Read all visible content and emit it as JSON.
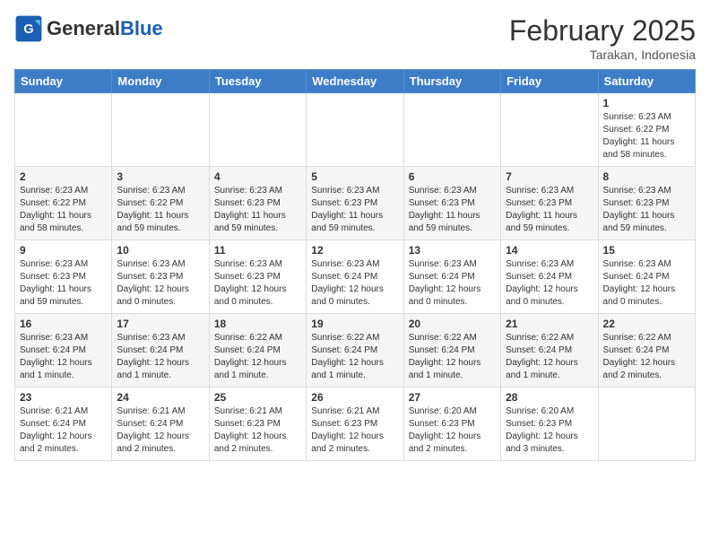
{
  "header": {
    "logo_general": "General",
    "logo_blue": "Blue",
    "month_title": "February 2025",
    "subtitle": "Tarakan, Indonesia"
  },
  "weekdays": [
    "Sunday",
    "Monday",
    "Tuesday",
    "Wednesday",
    "Thursday",
    "Friday",
    "Saturday"
  ],
  "weeks": [
    [
      {
        "day": "",
        "info": ""
      },
      {
        "day": "",
        "info": ""
      },
      {
        "day": "",
        "info": ""
      },
      {
        "day": "",
        "info": ""
      },
      {
        "day": "",
        "info": ""
      },
      {
        "day": "",
        "info": ""
      },
      {
        "day": "1",
        "info": "Sunrise: 6:23 AM\nSunset: 6:22 PM\nDaylight: 11 hours\nand 58 minutes."
      }
    ],
    [
      {
        "day": "2",
        "info": "Sunrise: 6:23 AM\nSunset: 6:22 PM\nDaylight: 11 hours\nand 58 minutes."
      },
      {
        "day": "3",
        "info": "Sunrise: 6:23 AM\nSunset: 6:22 PM\nDaylight: 11 hours\nand 59 minutes."
      },
      {
        "day": "4",
        "info": "Sunrise: 6:23 AM\nSunset: 6:23 PM\nDaylight: 11 hours\nand 59 minutes."
      },
      {
        "day": "5",
        "info": "Sunrise: 6:23 AM\nSunset: 6:23 PM\nDaylight: 11 hours\nand 59 minutes."
      },
      {
        "day": "6",
        "info": "Sunrise: 6:23 AM\nSunset: 6:23 PM\nDaylight: 11 hours\nand 59 minutes."
      },
      {
        "day": "7",
        "info": "Sunrise: 6:23 AM\nSunset: 6:23 PM\nDaylight: 11 hours\nand 59 minutes."
      },
      {
        "day": "8",
        "info": "Sunrise: 6:23 AM\nSunset: 6:23 PM\nDaylight: 11 hours\nand 59 minutes."
      }
    ],
    [
      {
        "day": "9",
        "info": "Sunrise: 6:23 AM\nSunset: 6:23 PM\nDaylight: 11 hours\nand 59 minutes."
      },
      {
        "day": "10",
        "info": "Sunrise: 6:23 AM\nSunset: 6:23 PM\nDaylight: 12 hours\nand 0 minutes."
      },
      {
        "day": "11",
        "info": "Sunrise: 6:23 AM\nSunset: 6:23 PM\nDaylight: 12 hours\nand 0 minutes."
      },
      {
        "day": "12",
        "info": "Sunrise: 6:23 AM\nSunset: 6:24 PM\nDaylight: 12 hours\nand 0 minutes."
      },
      {
        "day": "13",
        "info": "Sunrise: 6:23 AM\nSunset: 6:24 PM\nDaylight: 12 hours\nand 0 minutes."
      },
      {
        "day": "14",
        "info": "Sunrise: 6:23 AM\nSunset: 6:24 PM\nDaylight: 12 hours\nand 0 minutes."
      },
      {
        "day": "15",
        "info": "Sunrise: 6:23 AM\nSunset: 6:24 PM\nDaylight: 12 hours\nand 0 minutes."
      }
    ],
    [
      {
        "day": "16",
        "info": "Sunrise: 6:23 AM\nSunset: 6:24 PM\nDaylight: 12 hours\nand 1 minute."
      },
      {
        "day": "17",
        "info": "Sunrise: 6:23 AM\nSunset: 6:24 PM\nDaylight: 12 hours\nand 1 minute."
      },
      {
        "day": "18",
        "info": "Sunrise: 6:22 AM\nSunset: 6:24 PM\nDaylight: 12 hours\nand 1 minute."
      },
      {
        "day": "19",
        "info": "Sunrise: 6:22 AM\nSunset: 6:24 PM\nDaylight: 12 hours\nand 1 minute."
      },
      {
        "day": "20",
        "info": "Sunrise: 6:22 AM\nSunset: 6:24 PM\nDaylight: 12 hours\nand 1 minute."
      },
      {
        "day": "21",
        "info": "Sunrise: 6:22 AM\nSunset: 6:24 PM\nDaylight: 12 hours\nand 1 minute."
      },
      {
        "day": "22",
        "info": "Sunrise: 6:22 AM\nSunset: 6:24 PM\nDaylight: 12 hours\nand 2 minutes."
      }
    ],
    [
      {
        "day": "23",
        "info": "Sunrise: 6:21 AM\nSunset: 6:24 PM\nDaylight: 12 hours\nand 2 minutes."
      },
      {
        "day": "24",
        "info": "Sunrise: 6:21 AM\nSunset: 6:24 PM\nDaylight: 12 hours\nand 2 minutes."
      },
      {
        "day": "25",
        "info": "Sunrise: 6:21 AM\nSunset: 6:23 PM\nDaylight: 12 hours\nand 2 minutes."
      },
      {
        "day": "26",
        "info": "Sunrise: 6:21 AM\nSunset: 6:23 PM\nDaylight: 12 hours\nand 2 minutes."
      },
      {
        "day": "27",
        "info": "Sunrise: 6:20 AM\nSunset: 6:23 PM\nDaylight: 12 hours\nand 2 minutes."
      },
      {
        "day": "28",
        "info": "Sunrise: 6:20 AM\nSunset: 6:23 PM\nDaylight: 12 hours\nand 3 minutes."
      },
      {
        "day": "",
        "info": ""
      }
    ]
  ]
}
